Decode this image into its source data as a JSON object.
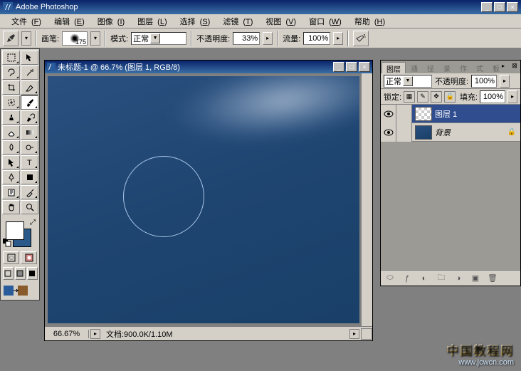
{
  "app": {
    "title": "Adobe Photoshop"
  },
  "menu": {
    "file": "文件",
    "file_u": "F",
    "edit": "编辑",
    "edit_u": "E",
    "image": "图像",
    "image_u": "I",
    "layer": "图层",
    "layer_u": "L",
    "select": "选择",
    "select_u": "S",
    "filter": "滤镜",
    "filter_u": "T",
    "view": "视图",
    "view_u": "V",
    "window": "窗口",
    "window_u": "W",
    "help": "帮助",
    "help_u": "H"
  },
  "opt": {
    "brush_label": "画笔:",
    "brush_size": "175",
    "mode_label": "模式:",
    "mode_value": "正常",
    "opacity_label": "不透明度:",
    "opacity_value": "33%",
    "flow_label": "流量:",
    "flow_value": "100%"
  },
  "doc": {
    "title": "未标题-1 @ 66.7% (图层 1, RGB/8)",
    "zoom": "66.67%",
    "status": "文档:900.0K/1.10M"
  },
  "panel": {
    "tab_layers": "图层",
    "tab_channels": "通",
    "tab_paths": "径",
    "tab_history": "录",
    "tab_actions": "作",
    "tab_toolpresets": "式",
    "tab_more": "板",
    "blend_value": "正常",
    "opacity_label": "不透明度:",
    "opacity_value": "100%",
    "lock_label": "锁定:",
    "fill_label": "填充:",
    "fill_value": "100%",
    "layer1": "图层 1",
    "layer_bg": "背景"
  },
  "watermark": {
    "cn": "中国教程网",
    "url": "www.jcwcn.com"
  }
}
